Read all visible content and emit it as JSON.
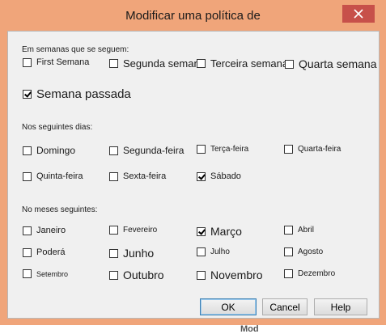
{
  "dialog": {
    "title": "Modificar uma política de",
    "close_glyph": "✕"
  },
  "weeks": {
    "heading": "Em semanas que se seguem:",
    "items": [
      {
        "label": "First Semana",
        "checked": false
      },
      {
        "label": "Segunda semana",
        "checked": false
      },
      {
        "label": "Terceira semana",
        "checked": false
      },
      {
        "label": "Quarta semana",
        "checked": false
      },
      {
        "label": "Semana passada",
        "checked": true
      }
    ]
  },
  "days": {
    "heading": "Nos seguintes dias:",
    "items": [
      {
        "label": "Domingo",
        "checked": false
      },
      {
        "label": "Segunda-feira",
        "checked": false
      },
      {
        "label": "Terça-feira",
        "checked": false
      },
      {
        "label": "Quarta-feira",
        "checked": false
      },
      {
        "label": "Quinta-feira",
        "checked": false
      },
      {
        "label": "Sexta-feira",
        "checked": false
      },
      {
        "label": "Sábado",
        "checked": true
      }
    ]
  },
  "months": {
    "heading": "No meses seguintes:",
    "items": [
      {
        "label": "Janeiro",
        "checked": false
      },
      {
        "label": "Fevereiro",
        "checked": false
      },
      {
        "label": "Março",
        "checked": true
      },
      {
        "label": "Abril",
        "checked": false
      },
      {
        "label": "Poderá",
        "checked": false
      },
      {
        "label": "Junho",
        "checked": false
      },
      {
        "label": "Julho",
        "checked": false
      },
      {
        "label": "Agosto",
        "checked": false
      },
      {
        "label": "Setembro",
        "checked": false
      },
      {
        "label": "Outubro",
        "checked": false
      },
      {
        "label": "Novembro",
        "checked": false
      },
      {
        "label": "Dezembro",
        "checked": false
      }
    ]
  },
  "buttons": {
    "ok": "OK",
    "cancel": "Cancel",
    "help": "Help"
  },
  "background_fragments": [
    "Mod"
  ]
}
